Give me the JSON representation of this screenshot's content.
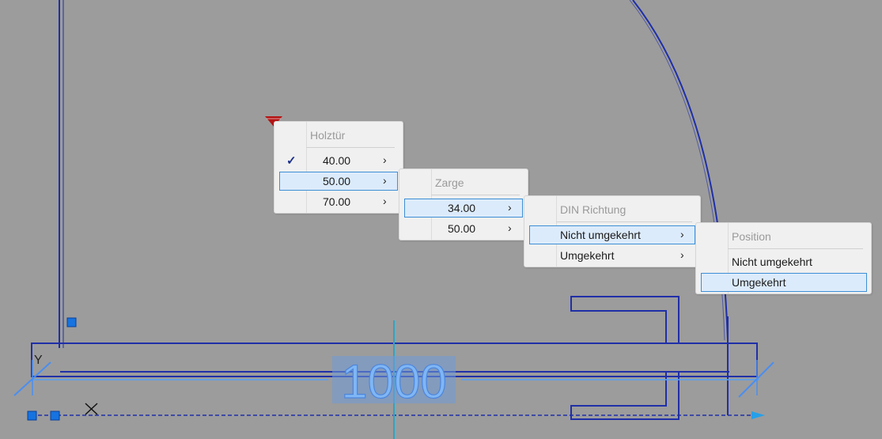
{
  "drawing": {
    "dimension_value": "1000",
    "ucs_y_label": "Y",
    "ucs_x_label": "X"
  },
  "menus": {
    "holztuer": {
      "header": "Holztür",
      "items": [
        {
          "label": "40.00",
          "checked": true,
          "selected": false,
          "submenu": true
        },
        {
          "label": "50.00",
          "checked": false,
          "selected": true,
          "submenu": true
        },
        {
          "label": "70.00",
          "checked": false,
          "selected": false,
          "submenu": true
        }
      ]
    },
    "zarge": {
      "header": "Zarge",
      "items": [
        {
          "label": "34.00",
          "selected": true,
          "submenu": true
        },
        {
          "label": "50.00",
          "selected": false,
          "submenu": true
        }
      ]
    },
    "din": {
      "header": "DIN Richtung",
      "items": [
        {
          "label": "Nicht umgekehrt",
          "selected": true,
          "submenu": true
        },
        {
          "label": "Umgekehrt",
          "selected": false,
          "submenu": true
        }
      ]
    },
    "position": {
      "header": "Position",
      "items": [
        {
          "label": "Nicht umgekehrt",
          "selected": false,
          "submenu": false
        },
        {
          "label": "Umgekehrt",
          "selected": true,
          "submenu": false
        }
      ]
    }
  },
  "glyphs": {
    "arrow": "›",
    "check": "✓"
  },
  "colors": {
    "canvas_bg": "#9c9c9c",
    "line": "#1f2fa8",
    "grip": "#1673e0",
    "highlight_bg": "#dcebfb",
    "highlight_border": "#3d8fd6",
    "marker": "#b41414"
  }
}
